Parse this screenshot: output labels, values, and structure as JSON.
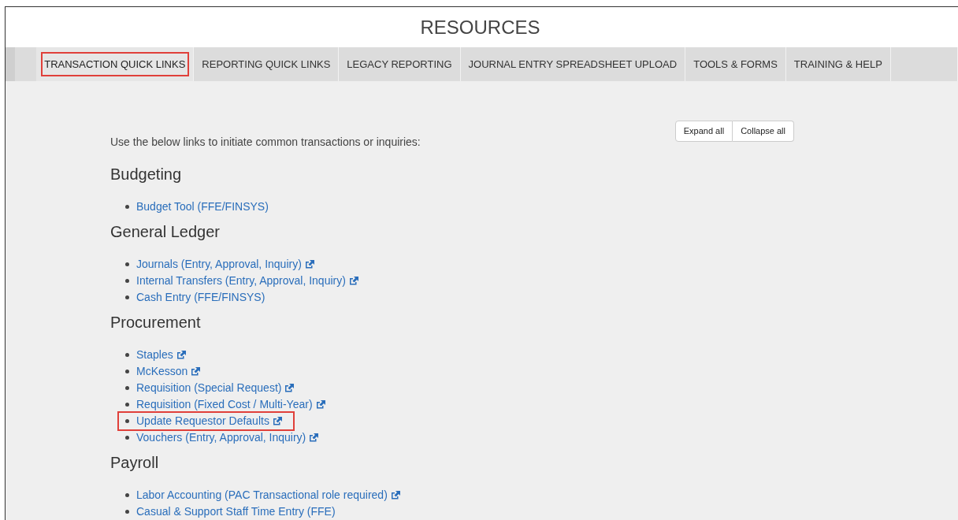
{
  "page_title": "RESOURCES",
  "tabs": [
    {
      "label": "TRANSACTION QUICK LINKS",
      "selected": true,
      "highlighted": true
    },
    {
      "label": "REPORTING QUICK LINKS",
      "selected": false,
      "highlighted": false
    },
    {
      "label": "LEGACY REPORTING",
      "selected": false,
      "highlighted": false
    },
    {
      "label": "JOURNAL ENTRY SPREADSHEET UPLOAD",
      "selected": false,
      "highlighted": false
    },
    {
      "label": "TOOLS & FORMS",
      "selected": false,
      "highlighted": false
    },
    {
      "label": "TRAINING & HELP",
      "selected": false,
      "highlighted": false
    }
  ],
  "buttons": [
    "Expand all",
    "Collapse all"
  ],
  "intro": "Use the below links to initiate common transactions or inquiries:",
  "sections": [
    {
      "heading": "Budgeting",
      "links": [
        {
          "label": "Budget Tool (FFE/FINSYS)",
          "external": false,
          "highlighted": false
        }
      ]
    },
    {
      "heading": "General Ledger",
      "links": [
        {
          "label": "Journals (Entry, Approval, Inquiry)",
          "external": true,
          "highlighted": false
        },
        {
          "label": "Internal Transfers (Entry, Approval, Inquiry)",
          "external": true,
          "highlighted": false
        },
        {
          "label": "Cash Entry (FFE/FINSYS)",
          "external": false,
          "highlighted": false
        }
      ]
    },
    {
      "heading": "Procurement",
      "links": [
        {
          "label": "Staples",
          "external": true,
          "highlighted": false
        },
        {
          "label": "McKesson",
          "external": true,
          "highlighted": false
        },
        {
          "label": "Requisition (Special Request)",
          "external": true,
          "highlighted": false
        },
        {
          "label": "Requisition (Fixed Cost / Multi-Year)",
          "external": true,
          "highlighted": false
        },
        {
          "label": "Update Requestor Defaults",
          "external": true,
          "highlighted": true
        },
        {
          "label": "Vouchers (Entry, Approval, Inquiry)",
          "external": true,
          "highlighted": false
        }
      ]
    },
    {
      "heading": "Payroll",
      "links": [
        {
          "label": "Labor Accounting (PAC Transactional role required)",
          "external": true,
          "highlighted": false
        },
        {
          "label": "Casual & Support Staff Time Entry (FFE)",
          "external": false,
          "highlighted": false
        }
      ]
    }
  ]
}
